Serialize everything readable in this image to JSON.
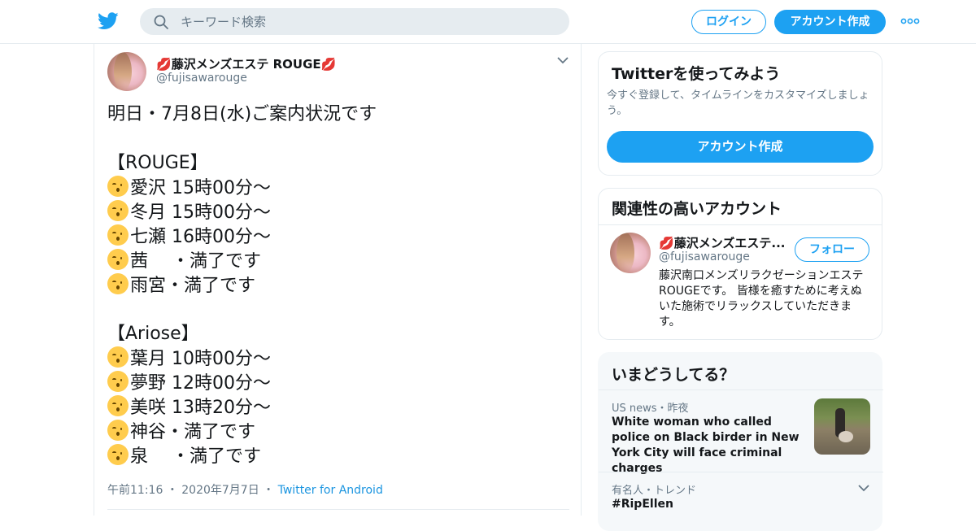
{
  "header": {
    "search_placeholder": "キーワード検索",
    "login_label": "ログイン",
    "signup_label": "アカウント作成"
  },
  "tweet": {
    "author_name": "藤沢メンズエステ ROUGE",
    "author_handle": "@fujisawarouge",
    "lines": [
      "明日・7月8日(水)ご案内状況です",
      "",
      "【ROUGE】",
      "愛沢 15時00分～",
      "冬月 15時00分～",
      "七瀬 16時00分～",
      "茜　 ・満了です",
      "雨宮・満了です",
      "",
      "【Ariose】",
      "葉月 10時00分～",
      "夢野 12時00分～",
      "美咲 13時20分～",
      "神谷・満了です",
      "泉　 ・満了です"
    ],
    "emoji_lines": [
      3,
      4,
      5,
      6,
      7,
      10,
      11,
      12,
      13,
      14
    ],
    "time": "午前11:16",
    "date": "2020年7月7日",
    "source": "Twitter for Android"
  },
  "signup_card": {
    "title": "Twitterを使ってみよう",
    "description": "今すぐ登録して、タイムラインをカスタマイズしましょう。",
    "button_label": "アカウント作成"
  },
  "related_card": {
    "title": "関連性の高いアカウント",
    "account_name": "藤沢メンズエステ...",
    "account_handle": "@fujisawarouge",
    "follow_label": "フォロー",
    "bio": "藤沢南口メンズリラクゼーションエステROUGEです。 皆様を癒すために考えぬいた施術でリラックスしていただきます。"
  },
  "trends_card": {
    "title": "いまどうしてる？",
    "news_category": "US news・昨夜",
    "news_headline": "White woman who called police on Black birder in New York City will face criminal charges",
    "trend_category": "有名人・トレンド",
    "trend_name": "#RipEllen"
  },
  "colors": {
    "accent": "#1da1f2",
    "link": "#1b95e0",
    "lips": "#d4145a",
    "secondary_text": "#657786"
  }
}
